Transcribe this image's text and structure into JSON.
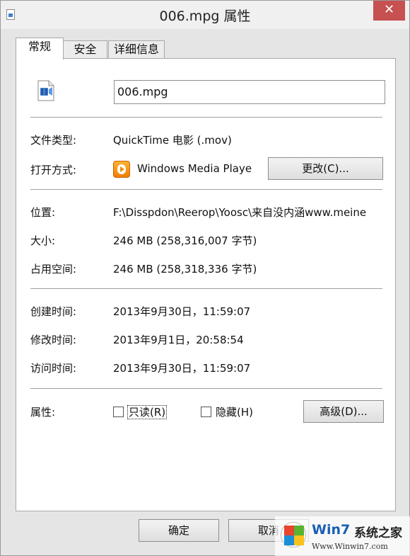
{
  "window": {
    "title": "006.mpg 属性",
    "close_label": "✕"
  },
  "tabs": [
    {
      "label": "常规",
      "active": true
    },
    {
      "label": "安全",
      "active": false
    },
    {
      "label": "详细信息",
      "active": false
    }
  ],
  "general": {
    "file_name": "006.mpg",
    "file_type_label": "文件类型:",
    "file_type_value": "QuickTime 电影 (.mov)",
    "opens_with_label": "打开方式:",
    "opens_with_value": "Windows Media Playe",
    "change_button": "更改(C)...",
    "location_label": "位置:",
    "location_value": "F:\\Disspdon\\Reerop\\Yoosc\\来自没内涵www.meine",
    "size_label": "大小:",
    "size_value": "246 MB (258,316,007 字节)",
    "size_on_disk_label": "占用空间:",
    "size_on_disk_value": "246 MB (258,318,336 字节)",
    "created_label": "创建时间:",
    "created_value": "2013年9月30日，11:59:07",
    "modified_label": "修改时间:",
    "modified_value": "2013年9月1日，20:58:54",
    "accessed_label": "访问时间:",
    "accessed_value": "2013年9月30日，11:59:07",
    "attributes_label": "属性:",
    "readonly_label": "只读(R)",
    "readonly_checked": false,
    "hidden_label": "隐藏(H)",
    "hidden_checked": false,
    "advanced_button": "高级(D)..."
  },
  "footer": {
    "ok_button": "确定",
    "cancel_button": "取消"
  },
  "watermark": {
    "brand": "Win7",
    "brand_suffix": "系统之家",
    "url": "Www.Winwin7.com"
  },
  "colors": {
    "close": "#c75050",
    "wmp_orange": "#f07d00",
    "watermark_blue": "#1a5fb4"
  },
  "icons": {
    "title": "video-file-icon",
    "file": "video-file-icon",
    "app": "windows-media-player-icon"
  }
}
